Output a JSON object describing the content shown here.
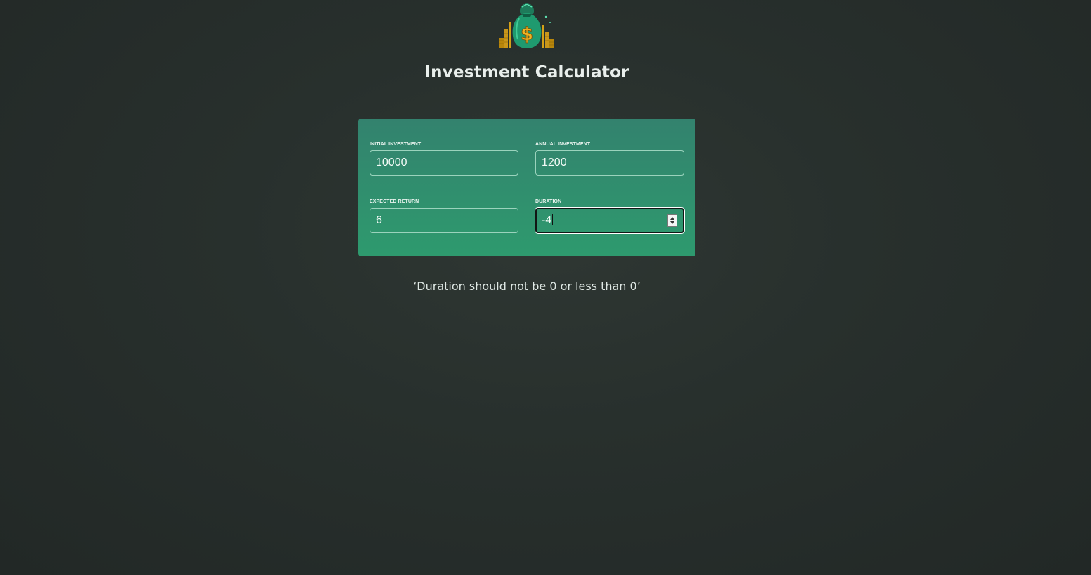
{
  "header": {
    "logo_icon": "money-bag-icon",
    "title": "Investment Calculator"
  },
  "inputs": {
    "initial_investment": {
      "label": "Initial Investment",
      "value": "10000"
    },
    "annual_investment": {
      "label": "Annual Investment",
      "value": "1200"
    },
    "expected_return": {
      "label": "Expected Return",
      "value": "6"
    },
    "duration": {
      "label": "Duration",
      "value": "-4"
    }
  },
  "error_message": "‘Duration should not be 0 or less than 0’",
  "colors": {
    "background": "#28302d",
    "card_top": "#33826e",
    "card_bottom": "#2e9a6e",
    "input_border": "#9bd3bd",
    "text": "#e9efec"
  }
}
